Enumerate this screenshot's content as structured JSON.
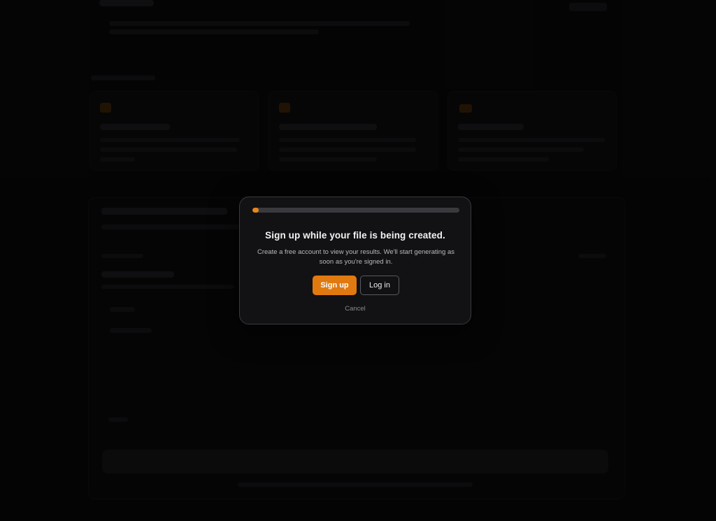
{
  "modal": {
    "progress_percent": 3,
    "progress_color": "#e8861a",
    "title": "Sign up while your file is being created.",
    "description": "Create a free account to view your results. We'll start generating as soon as you're signed in.",
    "primary_label": "Sign up",
    "secondary_label": "Log in",
    "cancel_label": "Cancel",
    "accent_color": "#e07a10"
  }
}
